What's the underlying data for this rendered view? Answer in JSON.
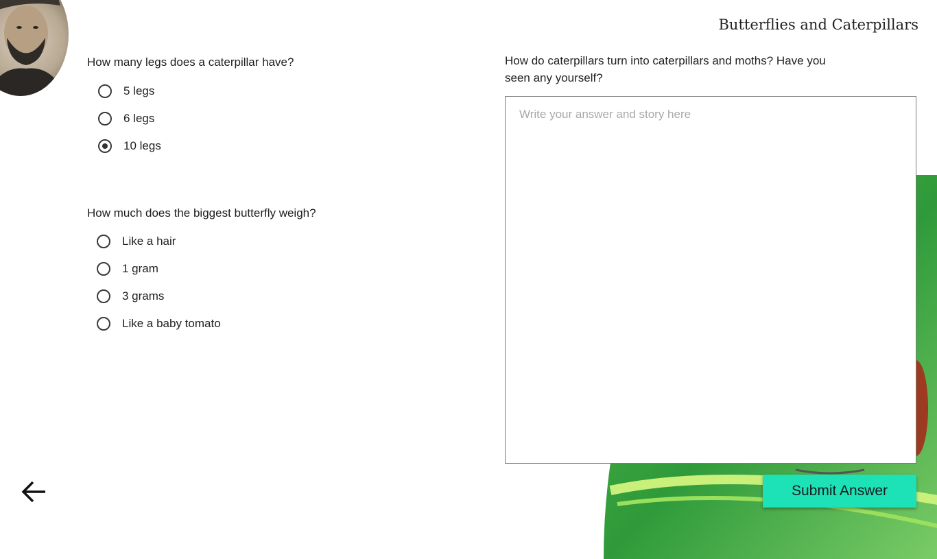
{
  "header": {
    "title": "Butterflies and Caterpillars"
  },
  "question1": {
    "prompt": "How many legs does a caterpillar have?",
    "options": [
      {
        "label": "5 legs",
        "checked": false
      },
      {
        "label": "6 legs",
        "checked": false
      },
      {
        "label": "10 legs",
        "checked": true
      }
    ]
  },
  "question2": {
    "prompt": "How much does the biggest butterfly weigh?",
    "options": [
      {
        "label": "Like a hair",
        "checked": false
      },
      {
        "label": "1 gram",
        "checked": false
      },
      {
        "label": "3 grams",
        "checked": false
      },
      {
        "label": "Like a baby tomato",
        "checked": false
      }
    ]
  },
  "question3": {
    "prompt_line1": "How do caterpillars turn into caterpillars and moths? Have you",
    "prompt_line2": "seen any yourself?",
    "placeholder": "Write your answer and story here",
    "value": ""
  },
  "actions": {
    "submit_label": "Submit Answer",
    "back_icon": "arrow-left-icon"
  },
  "colors": {
    "accent": "#1de2b8",
    "leaf_green": "#3fa63a"
  }
}
